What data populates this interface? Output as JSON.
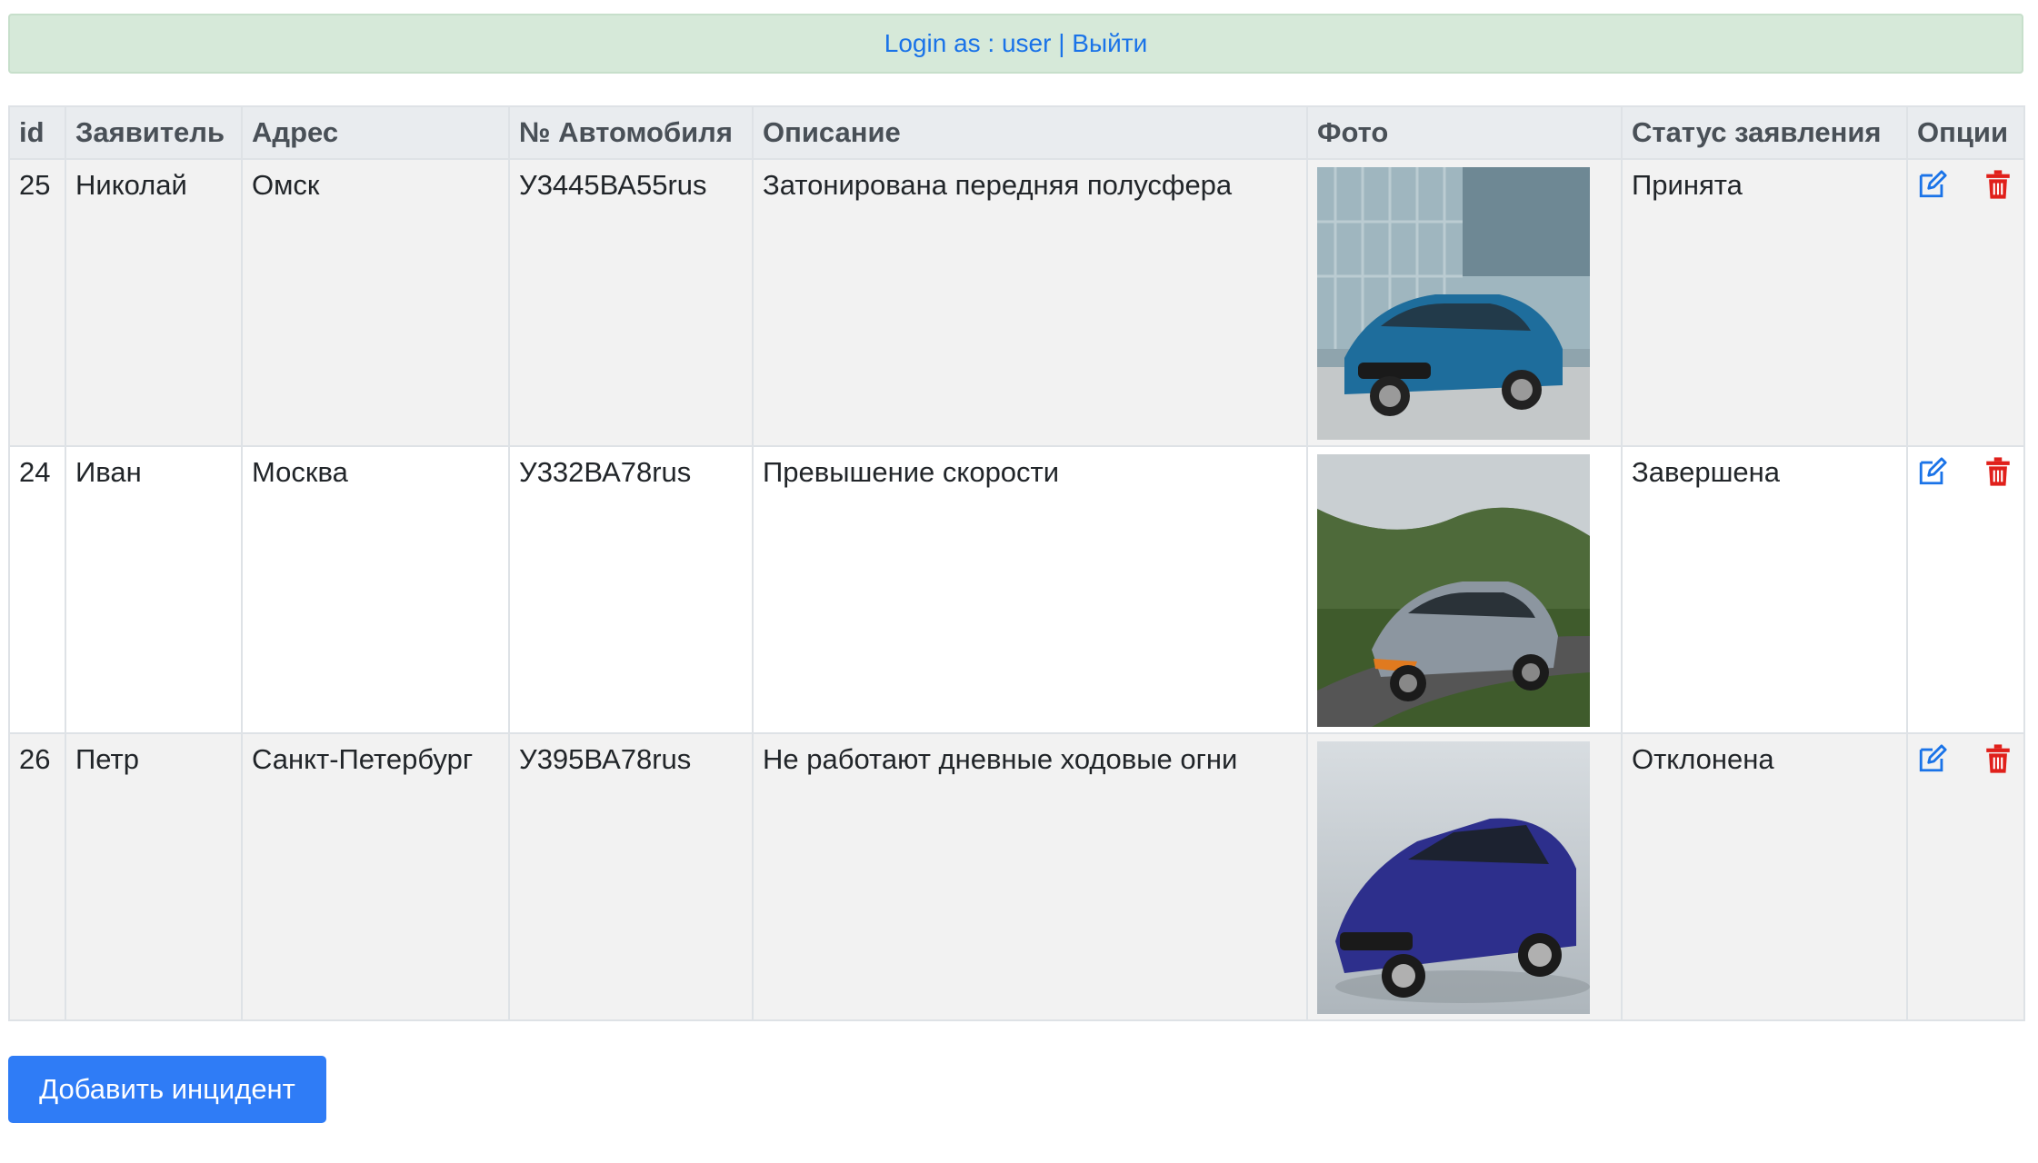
{
  "header": {
    "login_prefix": "Login as : ",
    "username": "user",
    "separator": " | ",
    "logout": "Выйти"
  },
  "table": {
    "columns": [
      "id",
      "Заявитель",
      "Адрес",
      "№ Автомобиля",
      "Описание",
      "Фото",
      "Статус заявления",
      "Опции"
    ],
    "rows": [
      {
        "id": "25",
        "applicant": "Николай",
        "address": "Омск",
        "car_number": "У3445ВА55rus",
        "description": "Затонирована передняя полусфера",
        "photo": "car-photo-blue-hatchback",
        "status": "Принята"
      },
      {
        "id": "24",
        "applicant": "Иван",
        "address": "Москва",
        "car_number": "У332ВА78rus",
        "description": "Превышение скорости",
        "photo": "car-photo-silver-concept",
        "status": "Завершена"
      },
      {
        "id": "26",
        "applicant": "Петр",
        "address": "Санкт-Петербург",
        "car_number": "У395ВА78rus",
        "description": "Не работают дневные ходовые огни",
        "photo": "car-photo-blue-crossover",
        "status": "Отклонена"
      }
    ]
  },
  "actions": {
    "add_incident": "Добавить инцидент"
  },
  "icons": {
    "edit": "edit-icon",
    "delete": "trash-icon"
  },
  "colors": {
    "link": "#1a73e8",
    "alert_bg": "#d6e9d9",
    "primary": "#2f7cf6",
    "danger": "#e0201b"
  }
}
